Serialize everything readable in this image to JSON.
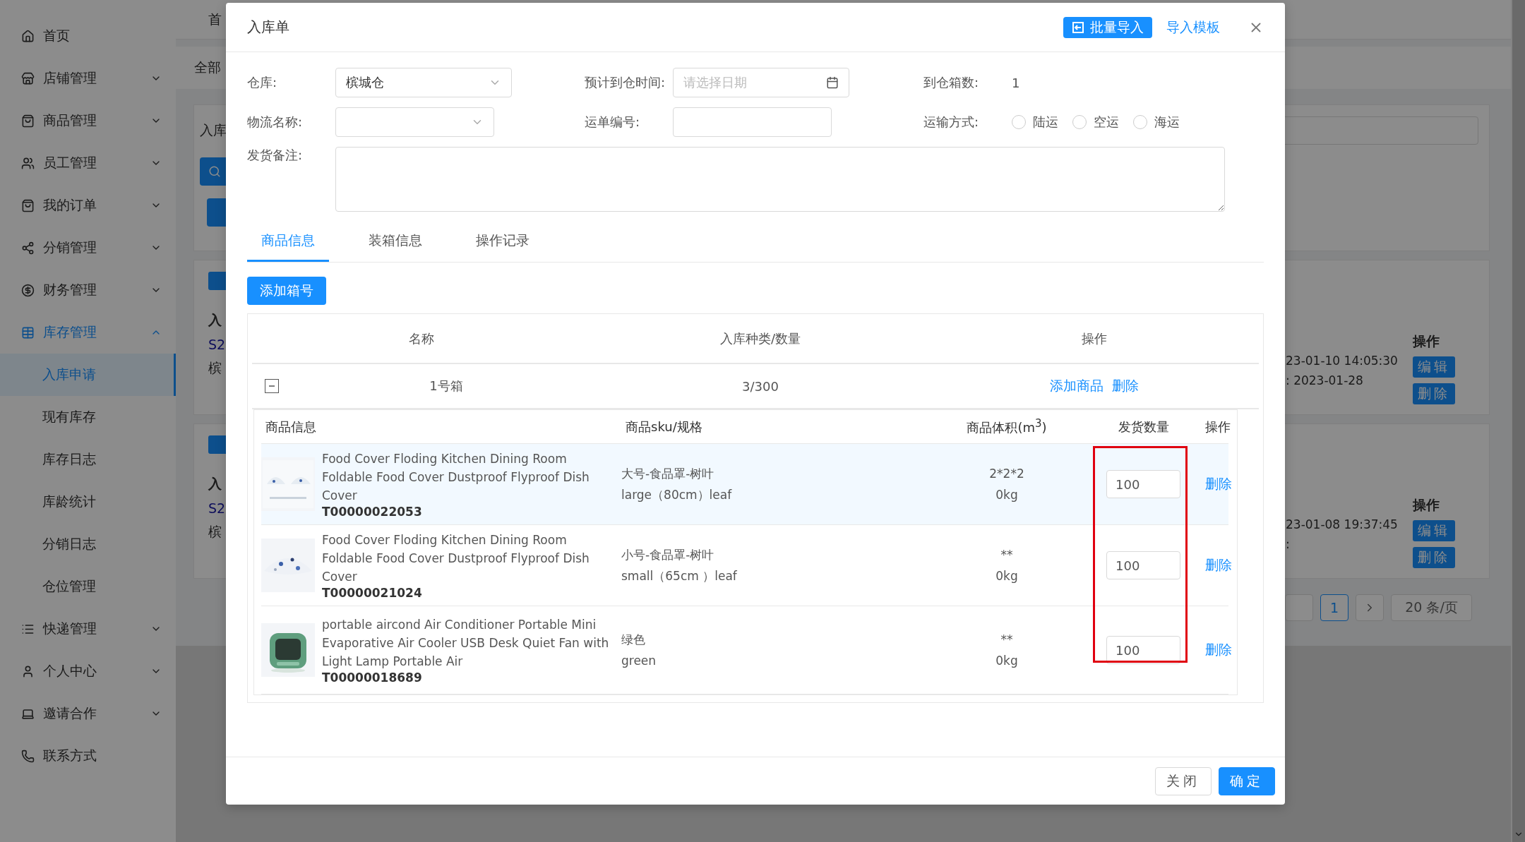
{
  "sidebar": {
    "items": [
      {
        "kind": "link",
        "label": "首页"
      },
      {
        "kind": "group",
        "label": "店铺管理",
        "expanded": false
      },
      {
        "kind": "group",
        "label": "商品管理",
        "expanded": false
      },
      {
        "kind": "group",
        "label": "员工管理",
        "expanded": false
      },
      {
        "kind": "group",
        "label": "我的订单",
        "expanded": false
      },
      {
        "kind": "group",
        "label": "分销管理",
        "expanded": false
      },
      {
        "kind": "group",
        "label": "财务管理",
        "expanded": false
      },
      {
        "kind": "group",
        "label": "库存管理",
        "expanded": true,
        "children": [
          {
            "label": "入库申请",
            "selected": true
          },
          {
            "label": "现有库存",
            "selected": false
          },
          {
            "label": "库存日志",
            "selected": false
          },
          {
            "label": "库龄统计",
            "selected": false
          },
          {
            "label": "分销日志",
            "selected": false
          },
          {
            "label": "仓位管理",
            "selected": false
          }
        ]
      },
      {
        "kind": "group",
        "label": "快递管理",
        "expanded": false
      },
      {
        "kind": "group",
        "label": "个人中心",
        "expanded": false
      },
      {
        "kind": "group",
        "label": "邀请合作",
        "expanded": false
      },
      {
        "kind": "link",
        "label": "联系方式"
      }
    ]
  },
  "background": {
    "header_tab": "首",
    "tab": "全部",
    "panel_title": "入库",
    "records": [
      {
        "title": "入",
        "code": "S2",
        "warehouse": "槟",
        "time": "23-01-10 14:05:30",
        "arrival": ":  2023-01-28",
        "actions_heading": "操作",
        "actions": [
          "编辑",
          "删除"
        ]
      },
      {
        "title": "入",
        "code": "S2",
        "warehouse": "槟",
        "time": "23-01-08 19:37:45",
        "arrival": ":",
        "actions_heading": "操作",
        "actions": [
          "编辑",
          "删除"
        ]
      }
    ],
    "pagination": {
      "pages": [
        {
          "label": "1",
          "selected": true
        }
      ],
      "page_size": "20 条/页"
    }
  },
  "dialog": {
    "title": "入库单",
    "import_button": "批量导入",
    "template_link": "导入模板",
    "form": {
      "warehouse": {
        "label": "仓库:",
        "value": "槟城仓"
      },
      "eta": {
        "label": "预计到仓时间:",
        "placeholder": "请选择日期"
      },
      "box_count": {
        "label": "到仓箱数:",
        "value": "1"
      },
      "logistics": {
        "label": "物流名称:"
      },
      "waybill": {
        "label": "运单编号:"
      },
      "transport": {
        "label": "运输方式:",
        "options": [
          {
            "label": "陆运",
            "selected": false
          },
          {
            "label": "空运",
            "selected": false
          },
          {
            "label": "海运",
            "selected": false
          }
        ]
      },
      "remark": {
        "label": "发货备注:"
      }
    },
    "tabs": [
      {
        "label": "商品信息",
        "selected": true
      },
      {
        "label": "装箱信息",
        "selected": false
      },
      {
        "label": "操作记录",
        "selected": false
      }
    ],
    "add_box_button": "添加箱号",
    "box_table": {
      "columns": [
        "名称",
        "入库种类/数量",
        "操作"
      ],
      "boxes": [
        {
          "name": "1号箱",
          "count": "3/300",
          "expanded": true,
          "actions": [
            "添加商品",
            "删除"
          ],
          "items_table": {
            "columns": [
              "商品信息",
              "商品sku/规格",
              "商品体积(m$^{3}$)",
              "发货数量",
              "操作"
            ],
            "rows": [
              {
                "title": "Food Cover Floding Kitchen Dining Room Foldable Food Cover Dustproof Flyproof Dish Cover",
                "code": "T00000022053",
                "sku": "大号-食品罩-树叶",
                "spec": "large（80cm）leaf",
                "volume": "2*2*2",
                "weight": "0kg",
                "quantity": "100",
                "action": "删除",
                "hovered": true
              },
              {
                "title": "Food Cover Floding Kitchen Dining Room Foldable Food Cover Dustproof Flyproof Dish Cover",
                "code": "T00000021024",
                "sku": "小号-食品罩-树叶",
                "spec": "small（65cm ）leaf",
                "volume": "**",
                "weight": "0kg",
                "quantity": "100",
                "action": "删除",
                "hovered": false
              },
              {
                "title": "portable aircond Air Conditioner Portable Mini Evaporative Air Cooler USB Desk Quiet Fan with Light Lamp Portable Air",
                "code": "T00000018689",
                "sku": "绿色",
                "spec": "green",
                "volume": "**",
                "weight": "0kg",
                "quantity": "100",
                "action": "删除",
                "hovered": false
              }
            ]
          }
        }
      ]
    },
    "footer": {
      "cancel": "关闭",
      "confirm": "确定"
    }
  }
}
